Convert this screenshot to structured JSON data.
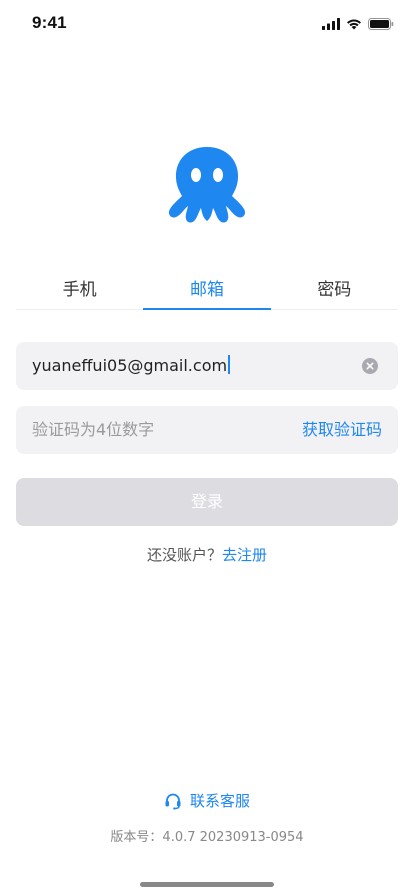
{
  "status_bar": {
    "time": "9:41"
  },
  "colors": {
    "accent": "#1f87f0",
    "disabled_button": "#dddde1",
    "field_bg": "#f2f2f4"
  },
  "logo": {
    "icon": "octopus-logo"
  },
  "tabs": [
    {
      "label": "手机",
      "active": false
    },
    {
      "label": "邮箱",
      "active": true
    },
    {
      "label": "密码",
      "active": false
    }
  ],
  "email": {
    "value": "yuaneffui05@gmail.com"
  },
  "code": {
    "placeholder": "验证码为4位数字",
    "get_code_label": "获取验证码"
  },
  "login_button": {
    "label": "登录",
    "enabled": false
  },
  "register": {
    "prompt": "还没账户？",
    "link": "去注册"
  },
  "support": {
    "label": "联系客服",
    "icon": "headset-icon"
  },
  "version": {
    "text": "版本号：4.0.7 20230913-0954"
  }
}
